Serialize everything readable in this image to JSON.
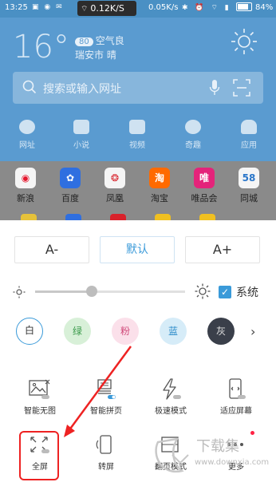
{
  "status_bar": {
    "time": "13:25",
    "net_speed": "0.12K/S",
    "net_speed_right": "0.05K/s",
    "battery": "84%"
  },
  "weather": {
    "temperature": "16°",
    "aqi_value": "80",
    "aqi_label": "空气良",
    "city_weather": "瑞安市 晴"
  },
  "search": {
    "placeholder": "搜索或输入网址"
  },
  "nav": {
    "items": [
      {
        "label": "网址"
      },
      {
        "label": "小说"
      },
      {
        "label": "视频"
      },
      {
        "label": "奇趣"
      },
      {
        "label": "应用"
      }
    ]
  },
  "apps": {
    "items": [
      {
        "label": "新浪",
        "color": "#f5f5f5",
        "glyph": "",
        "fg": "#e6162d"
      },
      {
        "label": "百度",
        "color": "#2f6fe0",
        "glyph": "",
        "fg": "#fff"
      },
      {
        "label": "凤凰",
        "color": "#f5f5f5",
        "glyph": "",
        "fg": "#d8222b"
      },
      {
        "label": "淘宝",
        "color": "#ff6a00",
        "glyph": "淘",
        "fg": "#fff"
      },
      {
        "label": "唯品会",
        "color": "#e4237a",
        "glyph": "唯",
        "fg": "#fff"
      },
      {
        "label": "同城",
        "color": "#f5f5f5",
        "glyph": "58",
        "fg": "#2a76c9"
      }
    ]
  },
  "reader_settings": {
    "font_decrease": "A-",
    "font_default": "默认",
    "font_increase": "A+",
    "brightness_level": 0.38,
    "system_brightness_label": "系统",
    "system_brightness_checked": true,
    "themes": [
      {
        "label": "白",
        "bg": "#ffffff",
        "fg": "#333333",
        "border": "#3a9ad9"
      },
      {
        "label": "绿",
        "bg": "#d8f0d8",
        "fg": "#3a9a4a",
        "border": "none"
      },
      {
        "label": "粉",
        "bg": "#fbe0ea",
        "fg": "#d04a7a",
        "border": "none"
      },
      {
        "label": "蓝",
        "bg": "#d6ecf8",
        "fg": "#2a8ac8",
        "border": "none"
      },
      {
        "label": "灰",
        "bg": "#3a3f4a",
        "fg": "#e0e0e0",
        "border": "none"
      }
    ],
    "modes": [
      {
        "label": "智能无图",
        "icon": "no-image-icon"
      },
      {
        "label": "智能拼页",
        "icon": "page-join-icon"
      },
      {
        "label": "极速模式",
        "icon": "lightning-icon"
      },
      {
        "label": "适应屏幕",
        "icon": "fit-screen-icon"
      },
      {
        "label": "全屏",
        "icon": "fullscreen-icon"
      },
      {
        "label": "转屏",
        "icon": "rotate-screen-icon"
      },
      {
        "label": "翻页模式",
        "icon": "page-flip-icon"
      },
      {
        "label": "更多",
        "icon": "more-icon"
      }
    ]
  },
  "watermark": {
    "brand": "下载集",
    "url": "www.downxia.com"
  }
}
